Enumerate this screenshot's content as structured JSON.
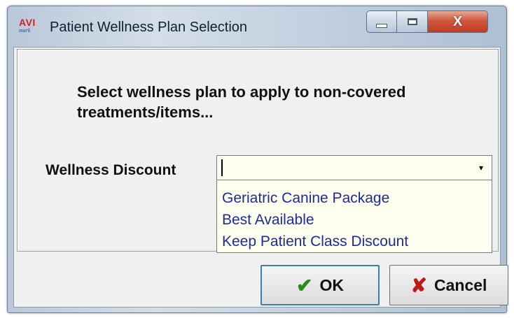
{
  "window": {
    "title": "Patient Wellness Plan Selection",
    "icon_text_top": "AVI",
    "icon_text_bottom": "mark"
  },
  "titlebar_buttons": {
    "minimize_icon": "minimize-icon",
    "maximize_icon": "maximize-icon",
    "close_glyph": "X"
  },
  "prompt": "Select wellness plan to apply to non-covered treatments/items...",
  "field": {
    "label": "Wellness Discount",
    "value": "",
    "arrow": "▾"
  },
  "dropdown": {
    "options": [
      "Geriatric Canine Package",
      "Best Available",
      "Keep Patient Class Discount"
    ]
  },
  "buttons": {
    "ok_icon": "✔",
    "ok_label": "OK",
    "cancel_icon": "✘",
    "cancel_label": "Cancel"
  },
  "colors": {
    "option_text": "#1c2aa0",
    "combo_background": "#fffff0",
    "ok_check": "#2a8a1c",
    "cancel_x": "#c01818"
  }
}
